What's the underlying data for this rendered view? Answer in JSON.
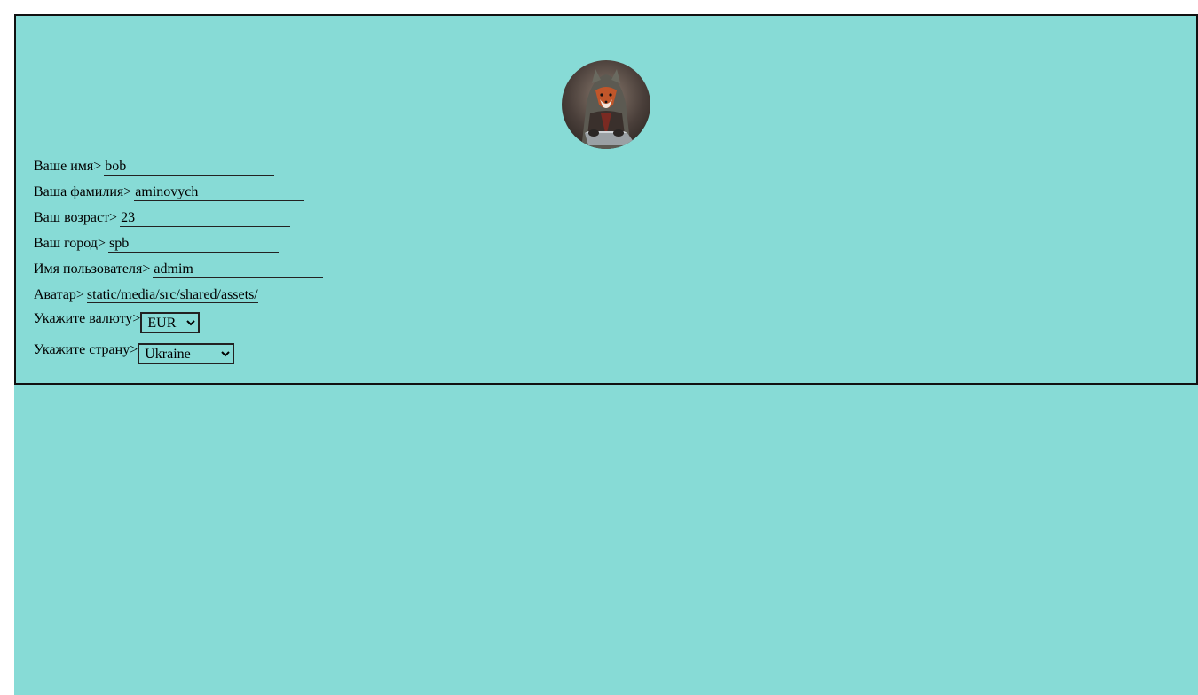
{
  "profile": {
    "avatar_icon": "fox-avatar-icon",
    "first_name": {
      "label": "Ваше имя>",
      "value": "bob"
    },
    "last_name": {
      "label": "Ваша фамилия>",
      "value": "aminovych"
    },
    "age": {
      "label": "Ваш возраст>",
      "value": "23"
    },
    "city": {
      "label": "Ваш город>",
      "value": "spb"
    },
    "username": {
      "label": "Имя пользователя>",
      "value": "admim"
    },
    "avatar": {
      "label": "Аватар>",
      "value": "static/media/src/shared/assets/"
    },
    "currency": {
      "label": "Укажите валюту>",
      "selected": "EUR"
    },
    "country": {
      "label": "Укажите страну>",
      "selected": "Ukraine"
    }
  },
  "colors": {
    "background": "#87dbd6",
    "border": "#111111"
  }
}
